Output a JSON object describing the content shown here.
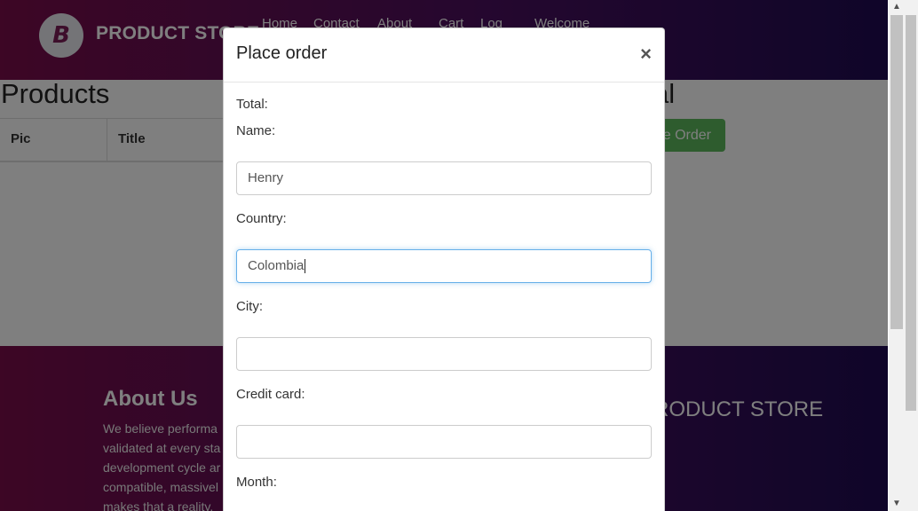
{
  "navbar": {
    "logo_letter": "B",
    "brand": "PRODUCT STORE",
    "links": [
      "Home",
      "Contact",
      "About",
      "Cart",
      "Log",
      "Welcome"
    ]
  },
  "main": {
    "products_title": "Products",
    "cart_title_tail": "al",
    "table_headers": [
      "Pic",
      "Title"
    ],
    "place_order_button": "Place Order"
  },
  "footer": {
    "about_title": "About Us",
    "about_lines": [
      "We believe performa",
      "validated at every sta",
      "development cycle ar",
      "compatible, massivel",
      "makes that a reality."
    ],
    "brand_tail": "RODUCT STORE"
  },
  "modal": {
    "title": "Place order",
    "close": "×",
    "total_label": "Total:",
    "name_label": "Name:",
    "name_value": "Henry",
    "country_label": "Country:",
    "country_value": "Colombia",
    "city_label": "City:",
    "city_value": "",
    "card_label": "Credit card:",
    "card_value": "",
    "month_label": "Month:"
  },
  "colors": {
    "header_gradient_start": "#7a0d4a",
    "header_gradient_end": "#1f0b52",
    "success_button": "#5cb85c",
    "focus_border": "#66afe9"
  }
}
